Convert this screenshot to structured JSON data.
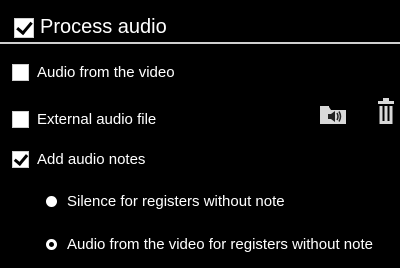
{
  "header": {
    "label": "Process audio",
    "checked": true
  },
  "options": {
    "video_audio": {
      "label": "Audio from the video",
      "checked": false
    },
    "external_audio": {
      "label": "External audio file",
      "checked": false
    },
    "audio_notes": {
      "label": "Add audio notes",
      "checked": true
    }
  },
  "radios": [
    {
      "label": "Silence for registers without note",
      "selected": true
    },
    {
      "label": "Audio from the video for registers without note",
      "selected": false
    }
  ],
  "icons": {
    "open_audio": "folder-audio-icon",
    "delete": "trash-icon"
  }
}
